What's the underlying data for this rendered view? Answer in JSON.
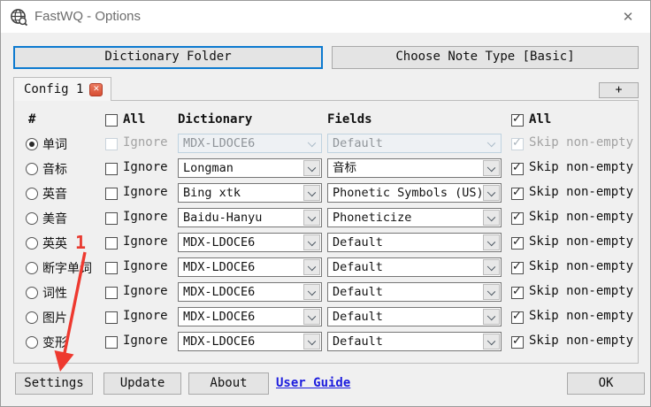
{
  "window": {
    "title": "FastWQ - Options",
    "close_glyph": "✕"
  },
  "top_buttons": {
    "dictionary_folder": "Dictionary Folder",
    "choose_note_type": "Choose Note Type [Basic]"
  },
  "tabs": {
    "active_label": "Config 1",
    "close_glyph": "✕",
    "add_label": "+"
  },
  "table": {
    "headers": {
      "hash": "#",
      "all_left": "All",
      "dictionary": "Dictionary",
      "fields": "Fields",
      "all_right": "All"
    },
    "header_all_left_checked": false,
    "header_all_right_checked": true,
    "ignore_label": "Ignore",
    "skip_label": "Skip non-empty",
    "rows": [
      {
        "label": "单词",
        "selected": true,
        "disabled": true,
        "ignore_checked": false,
        "dictionary": "MDX-LDOCE6",
        "field": "Default",
        "skip_checked": true
      },
      {
        "label": "音标",
        "selected": false,
        "disabled": false,
        "ignore_checked": false,
        "dictionary": "Longman",
        "field": "音标",
        "skip_checked": true
      },
      {
        "label": "英音",
        "selected": false,
        "disabled": false,
        "ignore_checked": false,
        "dictionary": "Bing xtk",
        "field": "Phonetic Symbols (US)",
        "skip_checked": true
      },
      {
        "label": "美音",
        "selected": false,
        "disabled": false,
        "ignore_checked": false,
        "dictionary": "Baidu-Hanyu",
        "field": "Phoneticize",
        "skip_checked": true
      },
      {
        "label": "英英",
        "selected": false,
        "disabled": false,
        "ignore_checked": false,
        "dictionary": "MDX-LDOCE6",
        "field": "Default",
        "skip_checked": true
      },
      {
        "label": "断字单词",
        "selected": false,
        "disabled": false,
        "ignore_checked": false,
        "dictionary": "MDX-LDOCE6",
        "field": "Default",
        "skip_checked": true
      },
      {
        "label": "词性",
        "selected": false,
        "disabled": false,
        "ignore_checked": false,
        "dictionary": "MDX-LDOCE6",
        "field": "Default",
        "skip_checked": true
      },
      {
        "label": "图片",
        "selected": false,
        "disabled": false,
        "ignore_checked": false,
        "dictionary": "MDX-LDOCE6",
        "field": "Default",
        "skip_checked": true
      },
      {
        "label": "变形",
        "selected": false,
        "disabled": false,
        "ignore_checked": false,
        "dictionary": "MDX-LDOCE6",
        "field": "Default",
        "skip_checked": true
      }
    ]
  },
  "footer": {
    "settings": "Settings",
    "update": "Update",
    "about": "About",
    "user_guide": "User Guide",
    "ok": "OK"
  },
  "annotation": {
    "number": "1",
    "color": "#e83a30"
  },
  "colors": {
    "focus_border": "#0d7ad0",
    "tab_close_bg": "#d74e33",
    "link_blue": "#1d1dde",
    "dialog_bg": "#f0f0f0"
  }
}
